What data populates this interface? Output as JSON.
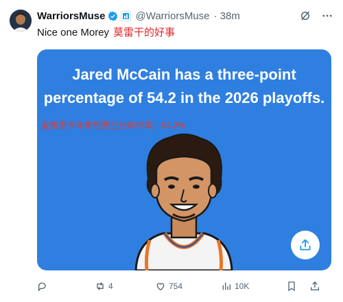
{
  "post": {
    "author_name": "WarriorsMuse",
    "handle": "@WarriorsMuse",
    "time": "· 38m",
    "text": "Nice one Morey",
    "text_cn": "莫雷干的好事"
  },
  "card": {
    "headline_line1": "Jared McCain has a three-point",
    "headline_line2": "percentage of 54.2 in the 2026 playoffs.",
    "caption_cn": "麦凯恩今年季后赛三分命中率：54.2%",
    "background_color": "#2f7fe0"
  },
  "actions": {
    "replies": "",
    "reposts": "4",
    "likes": "754",
    "views": "10K"
  },
  "icons": [
    "verified-icon",
    "affiliate-icon",
    "grok-icon",
    "more-icon",
    "share-icon",
    "reply-icon",
    "repost-icon",
    "like-icon",
    "views-icon",
    "bookmark-icon",
    "upload-icon"
  ]
}
